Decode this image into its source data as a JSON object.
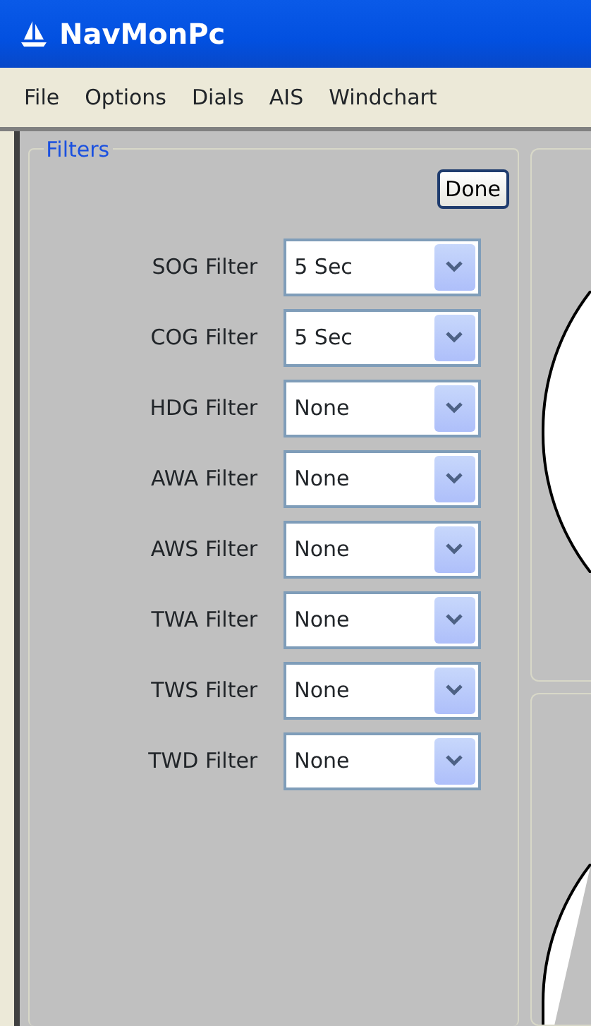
{
  "window": {
    "title": "NavMonPc"
  },
  "menu": [
    "File",
    "Options",
    "Dials",
    "AIS",
    "Windchart"
  ],
  "filters": {
    "title": "Filters",
    "done_button": "Done",
    "rows": [
      {
        "label": "SOG Filter",
        "value": "5 Sec"
      },
      {
        "label": "COG Filter",
        "value": "5 Sec"
      },
      {
        "label": "HDG Filter",
        "value": "None"
      },
      {
        "label": "AWA Filter",
        "value": "None"
      },
      {
        "label": "AWS Filter",
        "value": "None"
      },
      {
        "label": "TWA Filter",
        "value": "None"
      },
      {
        "label": "TWS Filter",
        "value": "None"
      },
      {
        "label": "TWD Filter",
        "value": "None"
      }
    ]
  }
}
